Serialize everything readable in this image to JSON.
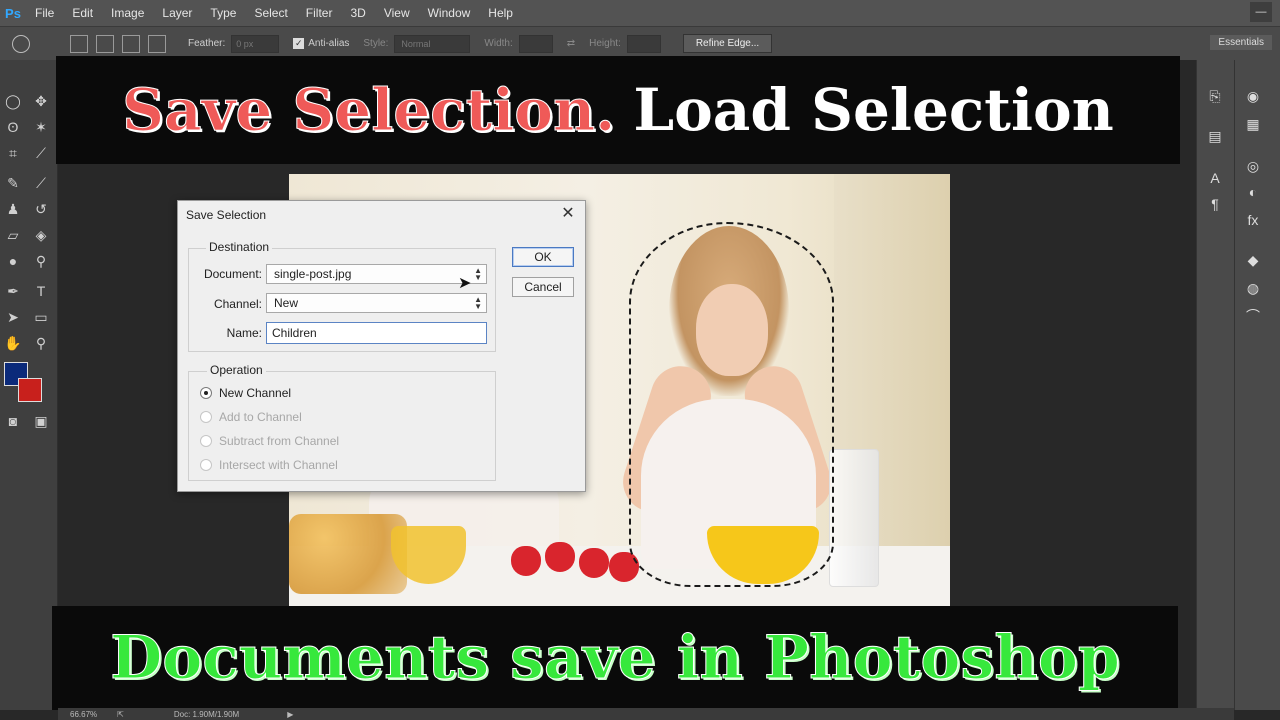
{
  "app": {
    "logo": "Ps"
  },
  "menu": [
    "File",
    "Edit",
    "Image",
    "Layer",
    "Type",
    "Select",
    "Filter",
    "3D",
    "View",
    "Window",
    "Help"
  ],
  "options_bar": {
    "feather_label": "Feather:",
    "feather_value": "0 px",
    "antialias_label": "Anti-alias",
    "style_label": "Style:",
    "style_value": "Normal",
    "width_label": "Width:",
    "height_label": "Height:",
    "refine_edge": "Refine Edge...",
    "workspace": "Essentials"
  },
  "banner_top": {
    "red_text": "Save Selection.",
    "white_text": "Load Selection"
  },
  "banner_bottom": {
    "text": "Documents save in Photoshop"
  },
  "dialog": {
    "title": "Save Selection",
    "destination_label": "Destination",
    "document_label": "Document:",
    "document_value": "single-post.jpg",
    "channel_label": "Channel:",
    "channel_value": "New",
    "name_label": "Name:",
    "name_value": "Children",
    "ok": "OK",
    "cancel": "Cancel",
    "operation_label": "Operation",
    "operations": [
      {
        "label": "New Channel",
        "selected": true,
        "enabled": true
      },
      {
        "label": "Add to Channel",
        "selected": false,
        "enabled": false
      },
      {
        "label": "Subtract from Channel",
        "selected": false,
        "enabled": false
      },
      {
        "label": "Intersect with Channel",
        "selected": false,
        "enabled": false
      }
    ]
  },
  "status": {
    "zoom": "66.67%",
    "doc": "Doc: 1.90M/1.90M"
  },
  "colors": {
    "foreground": "#0b2a7a",
    "background": "#c8201c"
  }
}
